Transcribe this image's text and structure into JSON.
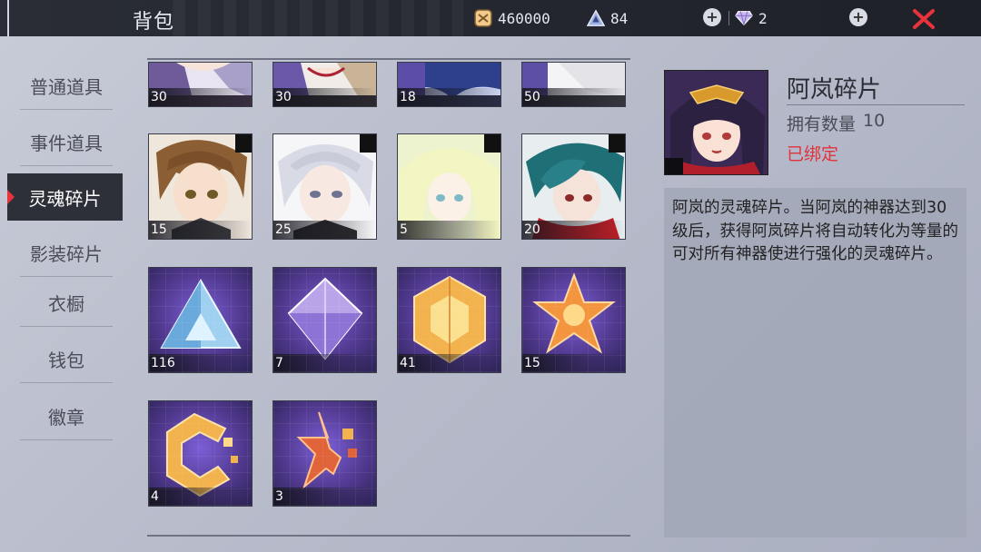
{
  "header": {
    "title": "背包",
    "coins": "460000",
    "stamina": "84",
    "diamonds": "2"
  },
  "tabs": [
    {
      "label": "普通道具",
      "active": false
    },
    {
      "label": "事件道具",
      "active": false
    },
    {
      "label": "灵魂碎片",
      "active": true
    },
    {
      "label": "影装碎片",
      "active": false
    },
    {
      "label": "衣橱",
      "active": false
    },
    {
      "label": "钱包",
      "active": false
    },
    {
      "label": "徽章",
      "active": false
    }
  ],
  "items": [
    {
      "count": "30",
      "kind": "character-fragment",
      "icon": "lavender-hair-portrait"
    },
    {
      "count": "30",
      "kind": "character-fragment",
      "icon": "blonde-hair-portrait"
    },
    {
      "count": "18",
      "kind": "character-fragment",
      "icon": "blue-hair-portrait"
    },
    {
      "count": "50",
      "kind": "character-fragment",
      "icon": "white-hair-portrait"
    },
    {
      "count": "15",
      "kind": "character-fragment",
      "icon": "brown-hair-boy-portrait"
    },
    {
      "count": "25",
      "kind": "character-fragment",
      "icon": "silver-hair-boy-portrait"
    },
    {
      "count": "5",
      "kind": "character-fragment",
      "icon": "pale-blonde-girl-portrait"
    },
    {
      "count": "20",
      "kind": "character-fragment",
      "icon": "teal-hair-boy-portrait"
    },
    {
      "count": "116",
      "kind": "general-fragment",
      "icon": "blue-triangle-crystal-icon"
    },
    {
      "count": "7",
      "kind": "general-fragment",
      "icon": "purple-diamond-crystal-icon"
    },
    {
      "count": "41",
      "kind": "general-fragment",
      "icon": "gold-hexagon-crystal-icon"
    },
    {
      "count": "15",
      "kind": "general-fragment",
      "icon": "gold-star-crystal-icon"
    },
    {
      "count": "4",
      "kind": "general-fragment",
      "icon": "gold-broken-hexagon-icon"
    },
    {
      "count": "3",
      "kind": "general-fragment",
      "icon": "red-broken-star-icon"
    }
  ],
  "detail": {
    "name": "阿岚碎片",
    "owned_label": "拥有数量",
    "owned_count": "10",
    "status": "已绑定",
    "description": "阿岚的灵魂碎片。当阿岚的神器达到30级后，获得阿岚碎片将自动转化为等量的可对所有神器使进行强化的灵魂碎片。"
  },
  "colors": {
    "accent_red": "#e0333d",
    "topbar": "#23262e",
    "active_tab": "#2d3039"
  }
}
